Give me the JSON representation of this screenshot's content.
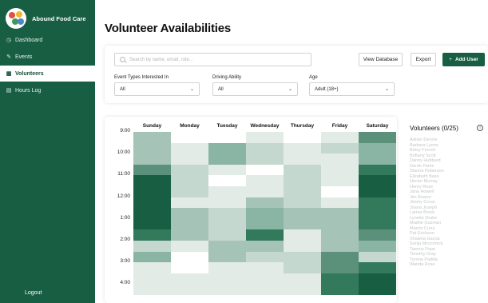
{
  "app": {
    "name": "Abound Food Care"
  },
  "sidebar": {
    "items": [
      {
        "label": "Dashboard",
        "icon": "clock-icon",
        "active": false
      },
      {
        "label": "Events",
        "icon": "edit-icon",
        "active": false
      },
      {
        "label": "Volunteers",
        "icon": "grid-icon",
        "active": true
      },
      {
        "label": "Hours Log",
        "icon": "list-icon",
        "active": false
      }
    ],
    "logout_label": "Logout"
  },
  "page": {
    "title": "Volunteer Availabilities"
  },
  "toolbar": {
    "search_placeholder": "Search by name, email, role...",
    "view_database_label": "View Database",
    "export_label": "Export",
    "add_user_label": "Add User"
  },
  "filters": {
    "event_types": {
      "label": "Event Types Interested In",
      "value": "All"
    },
    "driving": {
      "label": "Driving Ability",
      "value": "All"
    },
    "age": {
      "label": "Age",
      "value": "Adult (18+)"
    }
  },
  "chart_data": {
    "type": "heatmap",
    "days": [
      "Sunday",
      "Monday",
      "Tuesday",
      "Wednesday",
      "Thursday",
      "Friday",
      "Saturday"
    ],
    "time_labels": [
      "9:00",
      "10:00",
      "11:00",
      "12:00",
      "1:00",
      "2:00",
      "3:00",
      "4:00"
    ],
    "visible_rows": 15,
    "levels": [
      [
        3,
        0,
        0,
        1,
        0,
        1,
        5
      ],
      [
        3,
        1,
        4,
        2,
        1,
        2,
        4
      ],
      [
        3,
        1,
        4,
        2,
        1,
        1,
        4
      ],
      [
        5,
        2,
        1,
        0,
        2,
        1,
        6
      ],
      [
        7,
        2,
        0,
        1,
        2,
        1,
        7
      ],
      [
        7,
        2,
        1,
        1,
        2,
        0,
        7
      ],
      [
        7,
        1,
        1,
        3,
        2,
        1,
        6
      ],
      [
        7,
        3,
        2,
        4,
        3,
        3,
        6
      ],
      [
        7,
        3,
        2,
        4,
        3,
        3,
        6
      ],
      [
        6,
        3,
        2,
        6,
        1,
        3,
        5
      ],
      [
        2,
        1,
        3,
        3,
        1,
        3,
        4
      ],
      [
        4,
        0,
        3,
        2,
        2,
        5,
        2
      ],
      [
        1,
        0,
        1,
        1,
        2,
        5,
        6
      ],
      [
        1,
        1,
        1,
        1,
        1,
        6,
        7
      ],
      [
        1,
        1,
        1,
        1,
        1,
        6,
        7
      ]
    ],
    "palette": [
      "#ffffff",
      "#e3ebe7",
      "#c5d8cf",
      "#a5c3b6",
      "#8ab4a3",
      "#5b917a",
      "#33795b",
      "#175e43"
    ]
  },
  "volunteers": {
    "title": "Volunteers (0/25)",
    "names": [
      "Adrian Dennis",
      "Barbara Lyons",
      "Betsy French",
      "Brittany Scott",
      "Danny Hubbard",
      "Derek Parks",
      "Dianna Roberson",
      "Elizabeth Bass",
      "Hector Murray",
      "Henry Rose",
      "Jana Howell",
      "Jim Bowen",
      "Jimmy Cross",
      "Joana Joseph",
      "Lamar Brock",
      "Lynette Drake",
      "Madhe Guzman",
      "Marvin Curry",
      "Pat Erickson",
      "Shawna Garcia",
      "Sonja Mccormick",
      "Tammy Pope",
      "Timothy Gray",
      "Tyrone Padilla",
      "Wanda Rose"
    ]
  }
}
